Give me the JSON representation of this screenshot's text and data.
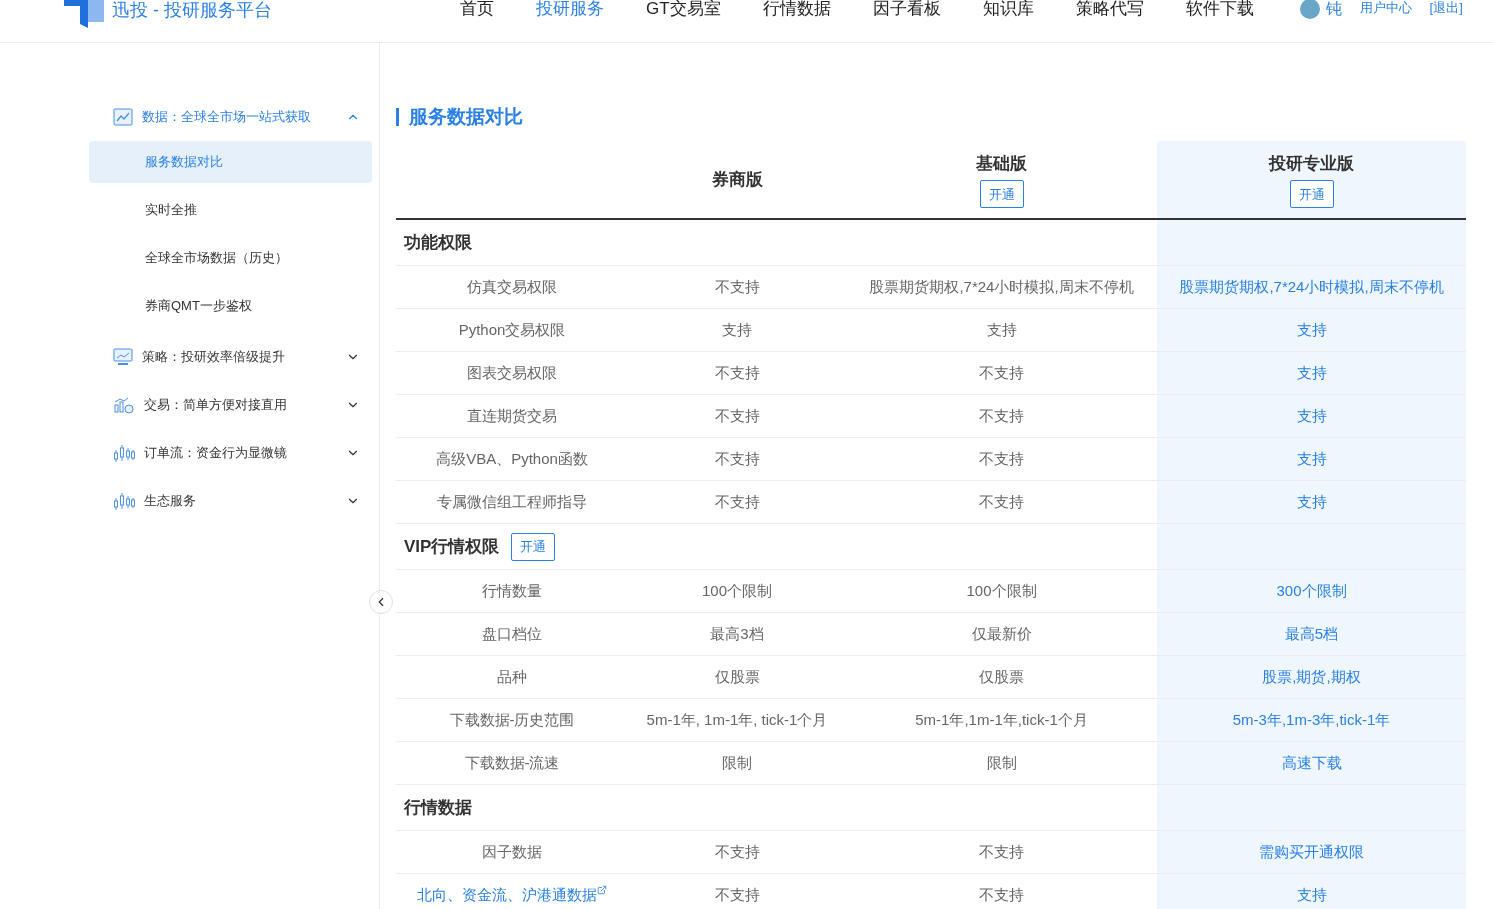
{
  "header": {
    "brand": "迅投 - 投研服务平台",
    "nav": [
      {
        "label": "首页",
        "selected": false
      },
      {
        "label": "投研服务",
        "selected": true
      },
      {
        "label": "GT交易室",
        "selected": false
      },
      {
        "label": "行情数据",
        "selected": false
      },
      {
        "label": "因子看板",
        "selected": false
      },
      {
        "label": "知识库",
        "selected": false
      },
      {
        "label": "策略代写",
        "selected": false
      },
      {
        "label": "软件下载",
        "selected": false
      }
    ],
    "user": {
      "name": "钝",
      "links": [
        "用户中心",
        "[退出]"
      ]
    }
  },
  "sidebar": {
    "groups": [
      {
        "kind": "chart",
        "label": "数据：全球全市场一站式获取",
        "expanded": true,
        "children": [
          {
            "label": "服务数据对比",
            "selected": true
          },
          {
            "label": "实时全推",
            "selected": false
          },
          {
            "label": "全球全市场数据（历史）",
            "selected": false
          },
          {
            "label": "券商QMT一步鉴权",
            "selected": false
          }
        ]
      },
      {
        "kind": "monitor",
        "label": "策略：投研效率倍级提升",
        "expanded": false
      },
      {
        "kind": "trade",
        "label": "交易：简单方便对接直用",
        "expanded": false
      },
      {
        "kind": "candles",
        "label": "订单流：资金行为显微镜",
        "expanded": false
      },
      {
        "kind": "candles",
        "label": "生态服务",
        "expanded": false
      }
    ]
  },
  "main": {
    "title": "服务数据对比",
    "columns": [
      {
        "label": "券商版",
        "highlighted": false
      },
      {
        "label": "基础版",
        "button": "开通",
        "highlighted": false
      },
      {
        "label": "投研专业版",
        "button": "开通",
        "highlighted": true
      }
    ],
    "sections": [
      {
        "title": "功能权限",
        "rows": [
          {
            "link": false,
            "cells": [
              "仿真交易权限",
              "不支持",
              "股票期货期权,7*24小时模拟,周末不停机",
              "股票期货期权,7*24小时模拟,周末不停机"
            ]
          },
          {
            "link": false,
            "cells": [
              "Python交易权限",
              "支持",
              "支持",
              "支持"
            ]
          },
          {
            "link": false,
            "cells": [
              "图表交易权限",
              "不支持",
              "不支持",
              "支持"
            ]
          },
          {
            "link": false,
            "cells": [
              "直连期货交易",
              "不支持",
              "不支持",
              "支持"
            ]
          },
          {
            "link": false,
            "cells": [
              "高级VBA、Python函数",
              "不支持",
              "不支持",
              "支持"
            ]
          },
          {
            "link": false,
            "cells": [
              "专属微信组工程师指导",
              "不支持",
              "不支持",
              "支持"
            ]
          }
        ]
      },
      {
        "title": "VIP行情权限",
        "button": "开通",
        "rows": [
          {
            "link": false,
            "cells": [
              "行情数量",
              "100个限制",
              "100个限制",
              "300个限制"
            ]
          },
          {
            "link": false,
            "cells": [
              "盘口档位",
              "最高3档",
              "仅最新价",
              "最高5档"
            ]
          },
          {
            "link": false,
            "cells": [
              "品种",
              "仅股票",
              "仅股票",
              "股票,期货,期权"
            ]
          },
          {
            "link": false,
            "cells": [
              "下载数据-历史范围",
              "5m-1年, 1m-1年, tick-1个月",
              "5m-1年,1m-1年,tick-1个月",
              "5m-3年,1m-3年,tick-1年"
            ]
          },
          {
            "link": false,
            "cells": [
              "下载数据-流速",
              "限制",
              "限制",
              "高速下载"
            ]
          }
        ]
      },
      {
        "title": "行情数据",
        "rows": [
          {
            "link": false,
            "cells": [
              "因子数据",
              "不支持",
              "不支持",
              "需购买开通权限"
            ]
          },
          {
            "link": true,
            "cells": [
              "北向、资金流、沪港通数据",
              "不支持",
              "不支持",
              "支持"
            ]
          }
        ]
      }
    ]
  }
}
